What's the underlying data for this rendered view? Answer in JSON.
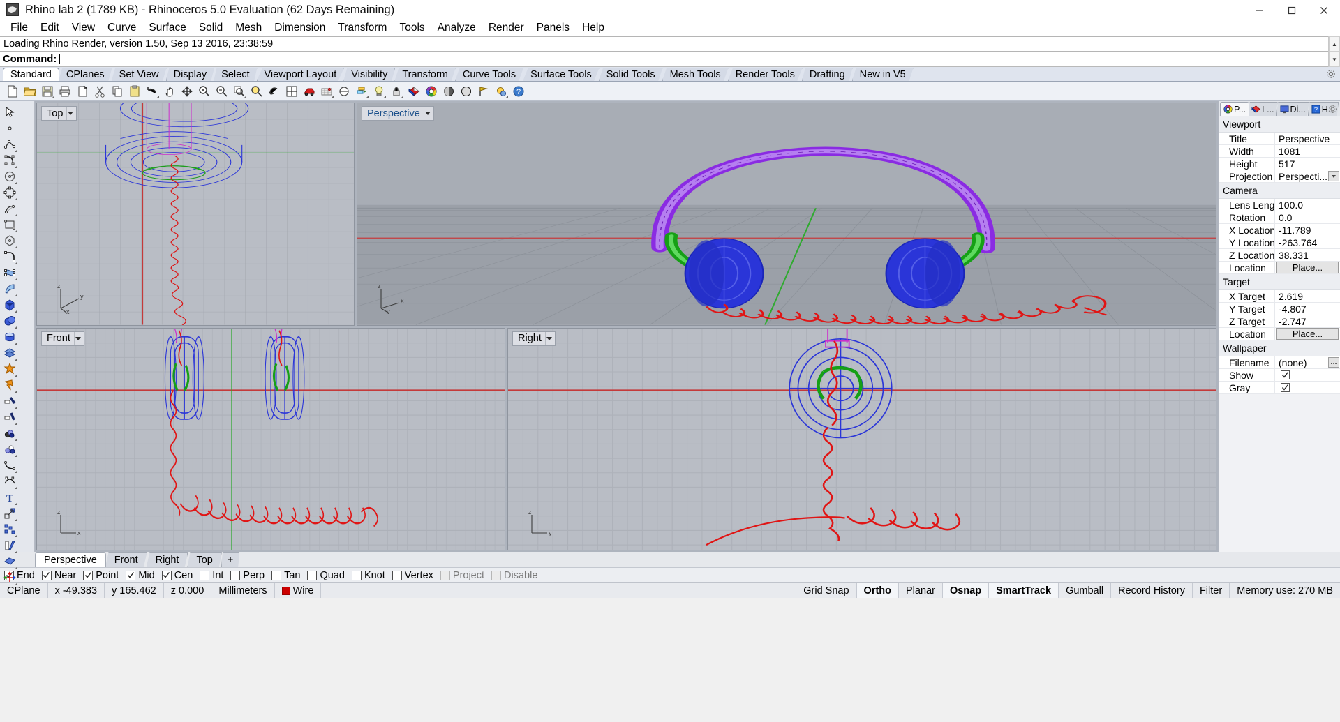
{
  "window": {
    "title": "Rhino lab 2 (1789 KB) - Rhinoceros 5.0 Evaluation (62 Days Remaining)",
    "app_icon": "rhino-icon",
    "minimize": "minimize-button",
    "maximize": "maximize-button",
    "close": "close-button"
  },
  "menu": {
    "items": [
      "File",
      "Edit",
      "View",
      "Curve",
      "Surface",
      "Solid",
      "Mesh",
      "Dimension",
      "Transform",
      "Tools",
      "Analyze",
      "Render",
      "Panels",
      "Help"
    ]
  },
  "command": {
    "history": "Loading Rhino Render, version 1.50, Sep 13 2016, 23:38:59",
    "label": "Command:",
    "value": "",
    "placeholder": ""
  },
  "toolbar_tabs": {
    "active": "Standard",
    "items": [
      "Standard",
      "CPlanes",
      "Set View",
      "Display",
      "Select",
      "Viewport Layout",
      "Visibility",
      "Transform",
      "Curve Tools",
      "Surface Tools",
      "Solid Tools",
      "Mesh Tools",
      "Render Tools",
      "Drafting",
      "New in V5"
    ]
  },
  "icon_toolbar": {
    "items": [
      {
        "name": "new-file-icon",
        "flyout": false
      },
      {
        "name": "open-file-icon",
        "flyout": false
      },
      {
        "name": "save-file-icon",
        "flyout": true
      },
      {
        "name": "print-icon",
        "flyout": false
      },
      {
        "name": "copy-to-clipboard-icon",
        "flyout": false
      },
      {
        "name": "cut-icon",
        "flyout": false
      },
      {
        "name": "copy-icon",
        "flyout": false
      },
      {
        "name": "paste-icon",
        "flyout": false
      },
      {
        "name": "undo-icon",
        "flyout": true
      },
      {
        "name": "pan-icon",
        "flyout": false
      },
      {
        "name": "zoom-dynamic-icon",
        "flyout": false
      },
      {
        "name": "zoom-in-icon",
        "flyout": false
      },
      {
        "name": "zoom-out-icon",
        "flyout": false
      },
      {
        "name": "zoom-window-icon",
        "flyout": true
      },
      {
        "name": "zoom-selected-icon",
        "flyout": false
      },
      {
        "name": "zoom-previous-icon",
        "flyout": false
      },
      {
        "name": "four-viewport-icon",
        "flyout": false
      },
      {
        "name": "render-icon",
        "flyout": false
      },
      {
        "name": "grid-snap-icon",
        "flyout": true
      },
      {
        "name": "object-snap-icon",
        "flyout": false
      },
      {
        "name": "layer-icon",
        "flyout": true
      },
      {
        "name": "light-icon",
        "flyout": true
      },
      {
        "name": "lock-icon",
        "flyout": true
      },
      {
        "name": "material-icon",
        "flyout": false
      },
      {
        "name": "color-wheel-icon",
        "flyout": false
      },
      {
        "name": "shaded-view-icon",
        "flyout": false
      },
      {
        "name": "ghosted-view-icon",
        "flyout": false
      },
      {
        "name": "flag-icon",
        "flyout": false
      },
      {
        "name": "options-icon",
        "flyout": true
      },
      {
        "name": "help-icon",
        "flyout": false
      }
    ]
  },
  "left_toolbar": {
    "items": [
      {
        "name": "select-arrow-icon",
        "flyout": false
      },
      {
        "name": "point-icon",
        "flyout": false
      },
      {
        "name": "polyline-icon",
        "flyout": true
      },
      {
        "name": "curve-control-points-icon",
        "flyout": true
      },
      {
        "name": "circle-icon",
        "flyout": true
      },
      {
        "name": "ellipse-icon",
        "flyout": true
      },
      {
        "name": "arc-icon",
        "flyout": true
      },
      {
        "name": "rectangle-icon",
        "flyout": true
      },
      {
        "name": "polygon-icon",
        "flyout": true
      },
      {
        "name": "curve-fillet-icon",
        "flyout": true
      },
      {
        "name": "surface-control-points-icon",
        "flyout": true
      },
      {
        "name": "extrude-surface-icon",
        "flyout": true
      },
      {
        "name": "box-solid-icon",
        "flyout": true
      },
      {
        "name": "sphere-solid-icon",
        "flyout": true
      },
      {
        "name": "cylinder-solid-icon",
        "flyout": true
      },
      {
        "name": "mesh-icon",
        "flyout": true
      },
      {
        "name": "boolean-union-icon",
        "flyout": true
      },
      {
        "name": "explode-icon",
        "flyout": true
      },
      {
        "name": "trim-icon",
        "flyout": true
      },
      {
        "name": "split-icon",
        "flyout": true
      },
      {
        "name": "join-icon",
        "flyout": true
      },
      {
        "name": "offset-icon",
        "flyout": true
      },
      {
        "name": "fillet-curve-icon",
        "flyout": true
      },
      {
        "name": "blend-curve-icon",
        "flyout": true
      },
      {
        "name": "text-icon",
        "flyout": true
      },
      {
        "name": "scale-icon",
        "flyout": true
      },
      {
        "name": "array-icon",
        "flyout": true
      },
      {
        "name": "mirror-icon",
        "flyout": true
      },
      {
        "name": "cap-icon",
        "flyout": true
      },
      {
        "name": "move-gumball-icon",
        "flyout": true
      }
    ]
  },
  "viewports": [
    {
      "name": "viewport-top",
      "label": "Top",
      "selected": false,
      "gizmo": {
        "v": "z",
        "h": "y",
        "d": "x"
      }
    },
    {
      "name": "viewport-perspective",
      "label": "Perspective",
      "selected": true,
      "gizmo": {
        "v": "z",
        "h": "x",
        "d": "y"
      }
    },
    {
      "name": "viewport-front",
      "label": "Front",
      "selected": false,
      "gizmo": {
        "v": "z",
        "h": "x",
        "d": ""
      }
    },
    {
      "name": "viewport-right",
      "label": "Right",
      "selected": false,
      "gizmo": {
        "v": "z",
        "h": "y",
        "d": ""
      }
    }
  ],
  "right_panel": {
    "tabs": [
      {
        "label": "P...",
        "icon": "properties-icon",
        "active": true
      },
      {
        "label": "L...",
        "icon": "layers-icon",
        "active": false
      },
      {
        "label": "Di...",
        "icon": "display-icon",
        "active": false
      },
      {
        "label": "H...",
        "icon": "help-panel-icon",
        "active": false
      }
    ],
    "gear": "panel-options-icon",
    "sections": [
      {
        "title": "Viewport",
        "rows": [
          {
            "key": "Title",
            "value": "Perspective",
            "type": "text"
          },
          {
            "key": "Width",
            "value": "1081",
            "type": "text"
          },
          {
            "key": "Height",
            "value": "517",
            "type": "text"
          },
          {
            "key": "Projection",
            "value": "Perspecti...",
            "type": "dropdown"
          }
        ]
      },
      {
        "title": "Camera",
        "rows": [
          {
            "key": "Lens Length",
            "value": "100.0",
            "type": "text"
          },
          {
            "key": "Rotation",
            "value": "0.0",
            "type": "text"
          },
          {
            "key": "X Location",
            "value": "-11.789",
            "type": "text"
          },
          {
            "key": "Y Location",
            "value": "-263.764",
            "type": "text"
          },
          {
            "key": "Z Location",
            "value": "38.331",
            "type": "text"
          },
          {
            "key": "Location",
            "value": "Place...",
            "type": "button"
          }
        ]
      },
      {
        "title": "Target",
        "rows": [
          {
            "key": "X Target",
            "value": "2.619",
            "type": "text"
          },
          {
            "key": "Y Target",
            "value": "-4.807",
            "type": "text"
          },
          {
            "key": "Z Target",
            "value": "-2.747",
            "type": "text"
          },
          {
            "key": "Location",
            "value": "Place...",
            "type": "button"
          }
        ]
      },
      {
        "title": "Wallpaper",
        "rows": [
          {
            "key": "Filename",
            "value": "(none)",
            "type": "file"
          },
          {
            "key": "Show",
            "value": "",
            "type": "checkbox",
            "checked": true
          },
          {
            "key": "Gray",
            "value": "",
            "type": "checkbox",
            "checked": true
          }
        ]
      }
    ]
  },
  "viewport_tabs": {
    "active": "Perspective",
    "items": [
      "Perspective",
      "Front",
      "Right",
      "Top"
    ],
    "add_label": "+"
  },
  "osnap": {
    "items": [
      {
        "label": "End",
        "checked": true,
        "disabled": false
      },
      {
        "label": "Near",
        "checked": true,
        "disabled": false
      },
      {
        "label": "Point",
        "checked": true,
        "disabled": false
      },
      {
        "label": "Mid",
        "checked": true,
        "disabled": false
      },
      {
        "label": "Cen",
        "checked": true,
        "disabled": false
      },
      {
        "label": "Int",
        "checked": false,
        "disabled": false
      },
      {
        "label": "Perp",
        "checked": false,
        "disabled": false
      },
      {
        "label": "Tan",
        "checked": false,
        "disabled": false
      },
      {
        "label": "Quad",
        "checked": false,
        "disabled": false
      },
      {
        "label": "Knot",
        "checked": false,
        "disabled": false
      },
      {
        "label": "Vertex",
        "checked": false,
        "disabled": false
      },
      {
        "label": "Project",
        "checked": false,
        "disabled": true
      },
      {
        "label": "Disable",
        "checked": false,
        "disabled": true
      }
    ]
  },
  "status": {
    "cplane": "CPlane",
    "x": "x -49.383",
    "y": "y 165.462",
    "z": "z 0.000",
    "units": "Millimeters",
    "layer_color": "#cc0000",
    "layer": "Wire",
    "toggles": [
      {
        "label": "Grid Snap",
        "bold": false
      },
      {
        "label": "Ortho",
        "bold": true
      },
      {
        "label": "Planar",
        "bold": false
      },
      {
        "label": "Osnap",
        "bold": true
      },
      {
        "label": "SmartTrack",
        "bold": true
      },
      {
        "label": "Gumball",
        "bold": false
      },
      {
        "label": "Record History",
        "bold": false
      },
      {
        "label": "Filter",
        "bold": false
      }
    ],
    "memory": "Memory use: 270 MB"
  }
}
